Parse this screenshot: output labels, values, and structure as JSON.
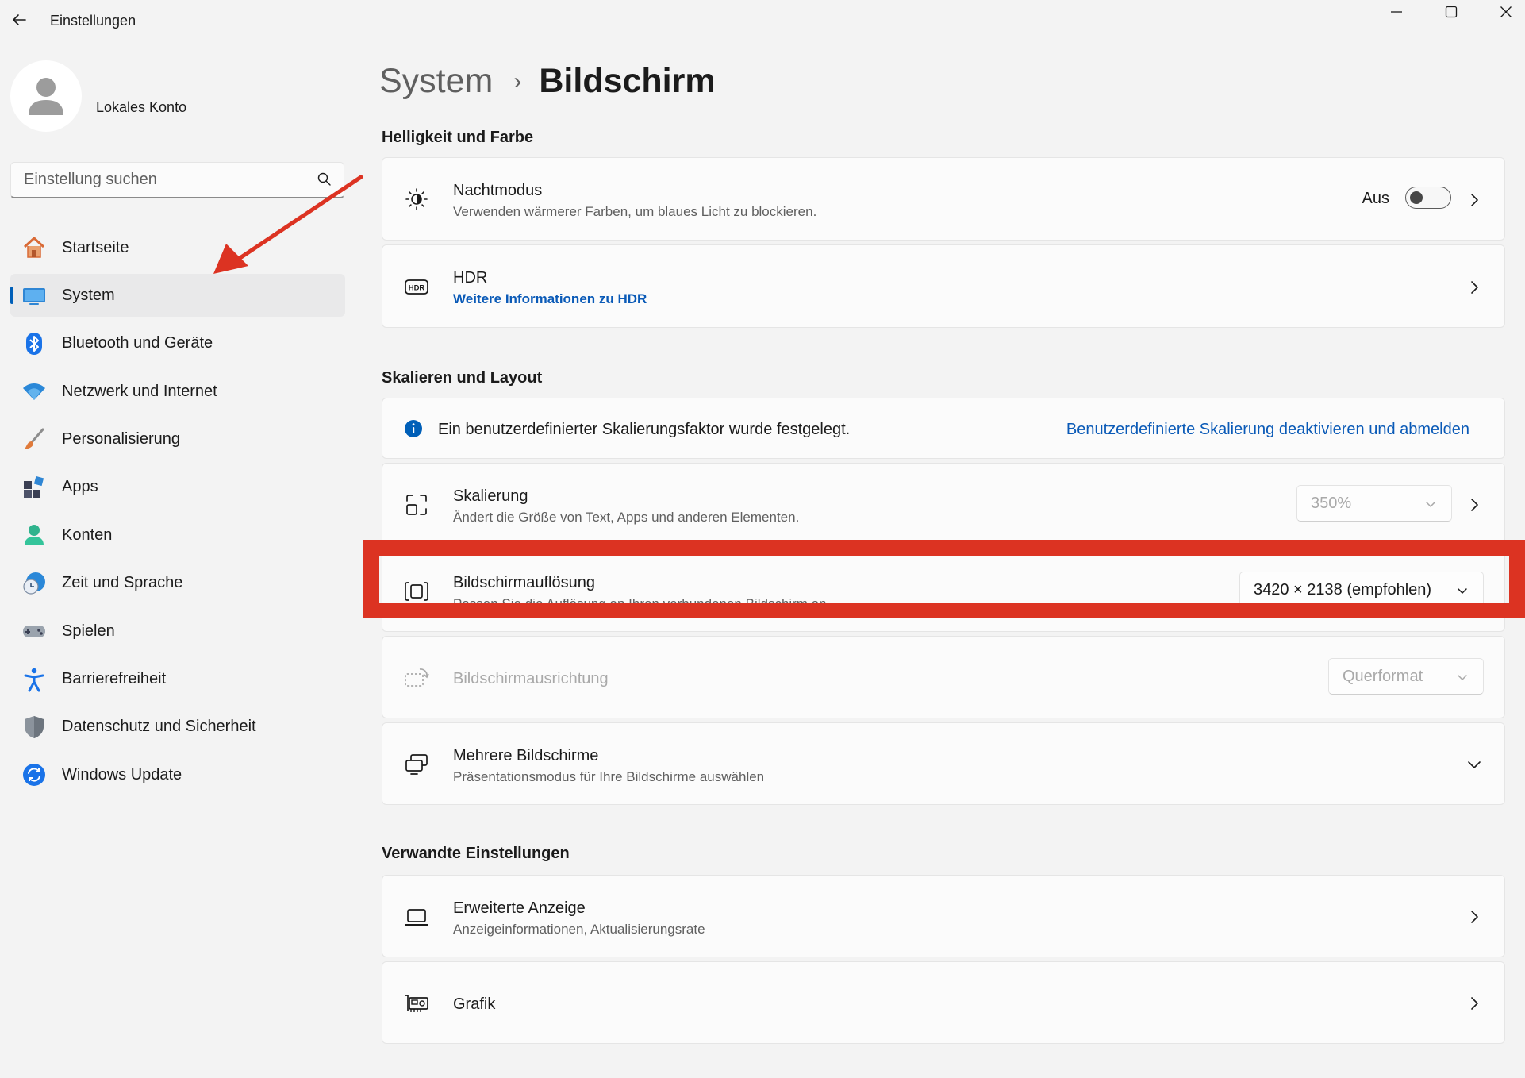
{
  "window": {
    "title": "Einstellungen",
    "controls": [
      "minimize-icon",
      "maximize-icon",
      "close-icon"
    ]
  },
  "account": {
    "name": "Lokales Konto",
    "avatar_icon": "person-icon"
  },
  "search": {
    "placeholder": "Einstellung suchen",
    "icon": "search-icon"
  },
  "sidebar": {
    "items": [
      {
        "label": "Startseite",
        "icon": "home-icon",
        "active": false
      },
      {
        "label": "System",
        "icon": "monitor-icon",
        "active": true
      },
      {
        "label": "Bluetooth und Geräte",
        "icon": "bluetooth-icon",
        "active": false
      },
      {
        "label": "Netzwerk und Internet",
        "icon": "wifi-icon",
        "active": false
      },
      {
        "label": "Personalisierung",
        "icon": "brush-icon",
        "active": false
      },
      {
        "label": "Apps",
        "icon": "apps-icon",
        "active": false
      },
      {
        "label": "Konten",
        "icon": "person-icon",
        "active": false
      },
      {
        "label": "Zeit und Sprache",
        "icon": "clock-globe-icon",
        "active": false
      },
      {
        "label": "Spielen",
        "icon": "gamepad-icon",
        "active": false
      },
      {
        "label": "Barrierefreiheit",
        "icon": "accessibility-icon",
        "active": false
      },
      {
        "label": "Datenschutz und Sicherheit",
        "icon": "shield-icon",
        "active": false
      },
      {
        "label": "Windows Update",
        "icon": "update-icon",
        "active": false
      }
    ]
  },
  "breadcrumb": {
    "parent": "System",
    "separator": "›",
    "current": "Bildschirm"
  },
  "sections": {
    "brightness": "Helligkeit und Farbe",
    "scale": "Skalieren und Layout",
    "related": "Verwandte Einstellungen"
  },
  "night": {
    "title": "Nachtmodus",
    "subtitle": "Verwenden wärmerer Farben, um blaues Licht zu blockieren.",
    "toggle_label": "Aus",
    "toggle_on": false,
    "icon": "brightness-icon"
  },
  "hdr": {
    "title": "HDR",
    "link": "Weitere Informationen zu HDR",
    "icon": "hdr-icon"
  },
  "info": {
    "text": "Ein benutzerdefinierter Skalierungsfaktor wurde festgelegt.",
    "link": "Benutzerdefinierte Skalierung deaktivieren und abmelden",
    "icon": "info-icon"
  },
  "scaling": {
    "title": "Skalierung",
    "subtitle": "Ändert die Größe von Text, Apps und anderen Elementen.",
    "value": "350%",
    "icon": "scale-icon"
  },
  "resolution": {
    "title": "Bildschirmauflösung",
    "subtitle": "Passen Sie die Auflösung an Ihren verbundenen Bildschirm an.",
    "value": "3420 × 2138 (empfohlen)",
    "icon": "resolution-icon"
  },
  "orientation": {
    "title": "Bildschirmausrichtung",
    "value": "Querformat",
    "icon": "rotate-screen-icon"
  },
  "multi": {
    "title": "Mehrere Bildschirme",
    "subtitle": "Präsentationsmodus für Ihre Bildschirme auswählen",
    "icon": "multi-monitor-icon"
  },
  "advanced": {
    "title": "Erweiterte Anzeige",
    "subtitle": "Anzeigeinformationen, Aktualisierungsrate",
    "icon": "laptop-icon"
  },
  "graphics": {
    "title": "Grafik",
    "icon": "gpu-icon"
  },
  "colors": {
    "accent": "#005fb8",
    "link": "#0a5ab7",
    "annotation": "#dc3322",
    "background": "#f3f3f3",
    "card": "#fbfbfb"
  }
}
